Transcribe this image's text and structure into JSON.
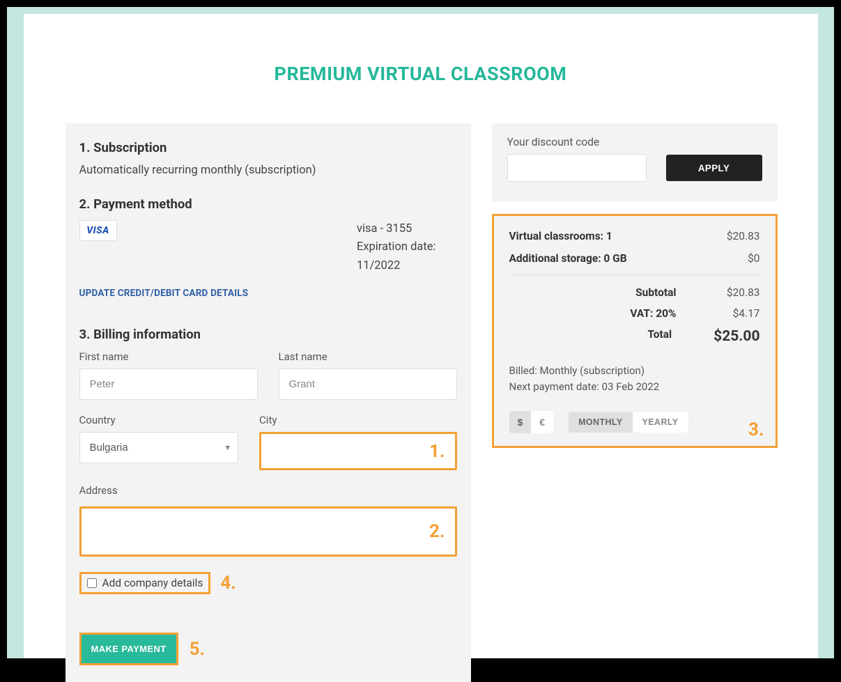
{
  "title": "PREMIUM VIRTUAL CLASSROOM",
  "sections": {
    "subscription": {
      "heading": "1. Subscription",
      "text": "Automatically recurring monthly (subscription)"
    },
    "payment": {
      "heading": "2. Payment method",
      "card_brand": "VISA",
      "card_summary": "visa - 3155",
      "exp_label": "Expiration date:",
      "exp_value": "11/2022",
      "update_link": "UPDATE CREDIT/DEBIT CARD DETAILS"
    },
    "billing": {
      "heading": "3. Billing information",
      "first_name_label": "First name",
      "first_name_value": "Peter",
      "last_name_label": "Last name",
      "last_name_value": "Grant",
      "country_label": "Country",
      "country_value": "Bulgaria",
      "city_label": "City",
      "city_value": "",
      "address_label": "Address",
      "address_value": "",
      "company_chk_label": "Add company details",
      "pay_button": "MAKE PAYMENT"
    }
  },
  "callouts": {
    "one": "1.",
    "two": "2.",
    "three": "3.",
    "four": "4.",
    "five": "5."
  },
  "promo": {
    "label": "Your discount code",
    "apply": "APPLY"
  },
  "summary": {
    "rooms_label": "Virtual classrooms: 1",
    "rooms_value": "$20.83",
    "storage_label": "Additional storage: 0 GB",
    "storage_value": "$0",
    "subtotal_label": "Subtotal",
    "subtotal_value": "$20.83",
    "vat_label": "VAT: 20%",
    "vat_value": "$4.17",
    "total_label": "Total",
    "total_value": "$25.00",
    "billed_text": "Billed: Monthly (subscription)",
    "next_payment": "Next payment date: 03 Feb 2022",
    "currency_usd": "$",
    "currency_eur": "€",
    "period_monthly": "MONTHLY",
    "period_yearly": "YEARLY"
  }
}
